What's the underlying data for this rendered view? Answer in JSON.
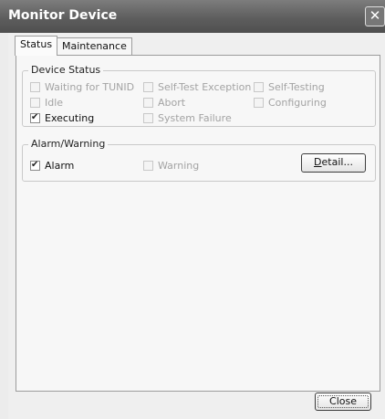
{
  "window": {
    "title": "Monitor Device",
    "close_glyph": "✕"
  },
  "tabs": [
    {
      "label": "Status",
      "active": true
    },
    {
      "label": "Maintenance",
      "active": false
    }
  ],
  "device_status": {
    "title": "Device Status",
    "items": [
      {
        "label": "Waiting for TUNID",
        "checked": false,
        "enabled": false
      },
      {
        "label": "Idle",
        "checked": false,
        "enabled": false
      },
      {
        "label": "Executing",
        "checked": true,
        "enabled": true
      },
      {
        "label": "Self-Test Exception",
        "checked": false,
        "enabled": false
      },
      {
        "label": "Abort",
        "checked": false,
        "enabled": false
      },
      {
        "label": "System Failure",
        "checked": false,
        "enabled": false
      },
      {
        "label": "Self-Testing",
        "checked": false,
        "enabled": false
      },
      {
        "label": "Configuring",
        "checked": false,
        "enabled": false
      }
    ]
  },
  "alarm_warning": {
    "title": "Alarm/Warning",
    "alarm": {
      "label": "Alarm",
      "checked": true,
      "enabled": true
    },
    "warning": {
      "label": "Warning",
      "checked": false,
      "enabled": false
    },
    "detail_button": {
      "label_underlined": "D",
      "label_rest": "etail..."
    }
  },
  "footer": {
    "close_label": "Close"
  },
  "check_glyph": "✔"
}
